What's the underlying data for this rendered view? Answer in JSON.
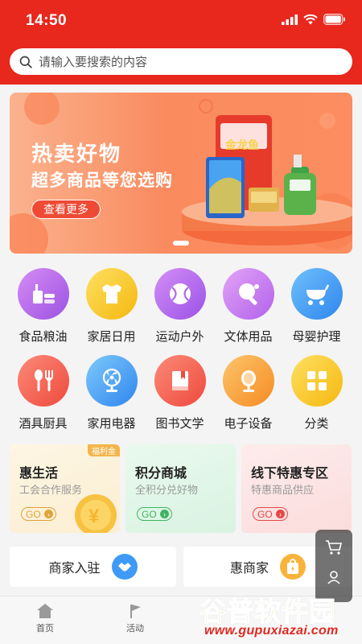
{
  "status_bar": {
    "time": "14:50"
  },
  "search": {
    "placeholder": "请输入要搜索的内容"
  },
  "banner": {
    "title": "热卖好物",
    "subtitle": "超多商品等您选购",
    "button": "查看更多"
  },
  "categories_row1": [
    {
      "label": "食品粮油",
      "icon": "food-icon",
      "color": "#b06ae6"
    },
    {
      "label": "家居日用",
      "icon": "shirt-icon",
      "color": "#f8c927"
    },
    {
      "label": "运动户外",
      "icon": "ball-icon",
      "color": "#b468ec"
    },
    {
      "label": "文体用品",
      "icon": "pingpong-icon",
      "color": "#c270ec"
    },
    {
      "label": "母婴护理",
      "icon": "stroller-icon",
      "color": "#3f9af5"
    }
  ],
  "categories_row2": [
    {
      "label": "酒具厨具",
      "icon": "cutlery-icon",
      "color": "#f45b4f"
    },
    {
      "label": "家用电器",
      "icon": "fan-icon",
      "color": "#3f9af5"
    },
    {
      "label": "图书文学",
      "icon": "book-icon",
      "color": "#f45b4f"
    },
    {
      "label": "电子设备",
      "icon": "mirror-icon",
      "color": "#f8a43a"
    },
    {
      "label": "分类",
      "icon": "grid-icon",
      "color": "#f8c927"
    }
  ],
  "promo_cards": [
    {
      "title": "惠生活",
      "subtitle": "工会合作服务",
      "go": "GO",
      "tag": "福利金",
      "bg": "#fdf3dc",
      "accent": "#e0a33a"
    },
    {
      "title": "积分商城",
      "subtitle": "全积分兑好物",
      "go": "GO",
      "tag": "",
      "bg": "#e4f7ea",
      "accent": "#3fb460"
    },
    {
      "title": "线下特惠专区",
      "subtitle": "特惠商品供应",
      "go": "GO",
      "tag": "",
      "bg": "#fde6e6",
      "accent": "#e54848"
    }
  ],
  "merchants": [
    {
      "label": "商家入驻",
      "icon": "handshake-icon",
      "color": "#3f9af5"
    },
    {
      "label": "惠商家",
      "icon": "bag-icon",
      "color": "#f8b43a"
    }
  ],
  "tabbar": [
    {
      "label": "首页",
      "icon": "home-icon"
    },
    {
      "label": "活动",
      "icon": "flag-icon"
    }
  ],
  "watermark": {
    "title": "谷普软件园",
    "url": "www.gupuxiazai.com"
  }
}
